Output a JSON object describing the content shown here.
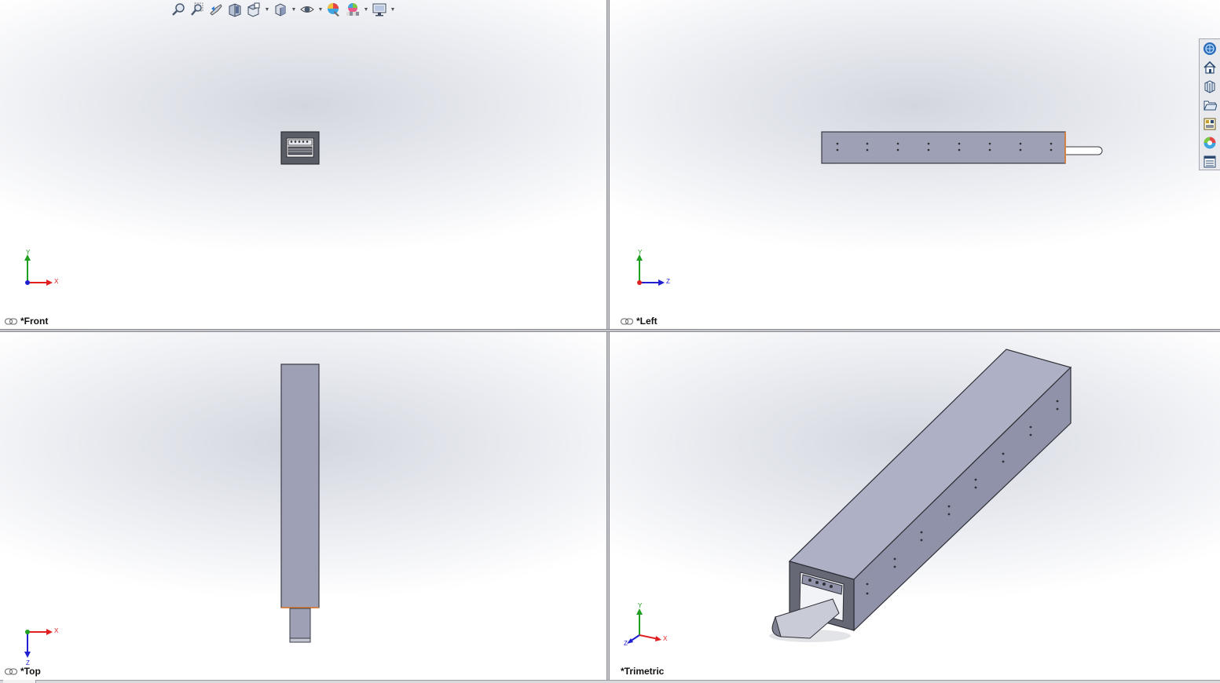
{
  "views": {
    "front": {
      "label": "*Front",
      "triad": {
        "up": "Y",
        "right": "X"
      }
    },
    "left": {
      "label": "*Left",
      "triad": {
        "up": "Y",
        "right": "Z"
      }
    },
    "top": {
      "label": "*Top",
      "triad": {
        "down": "Z",
        "right": "X"
      }
    },
    "trimetric": {
      "label": "*Trimetric",
      "triad": {
        "up": "Y",
        "right": "X",
        "left": "Z"
      }
    }
  },
  "toolbar": {
    "icons": [
      "zoom-to-fit-icon",
      "zoom-to-area-icon",
      "previous-view-icon",
      "section-view-icon",
      "view-orientation-icon",
      "display-style-icon",
      "hide-show-items-icon",
      "edit-appearance-icon",
      "apply-scene-icon",
      "view-settings-icon"
    ]
  },
  "task_pane": {
    "icons": [
      "solidworks-resources-icon",
      "home-icon",
      "design-library-icon",
      "file-explorer-icon",
      "view-palette-icon",
      "appearances-icon",
      "custom-properties-icon"
    ]
  },
  "colors": {
    "part_face": "#9ea1b5",
    "part_edge": "#3a3b44",
    "edge_highlight": "#e07a2a",
    "axis_x": "#e02020",
    "axis_y": "#20a020",
    "axis_z": "#2020d0"
  }
}
